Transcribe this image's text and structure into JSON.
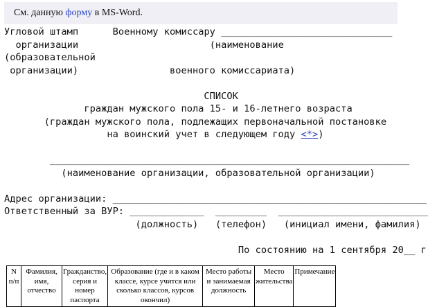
{
  "note": {
    "prefix": "См. данную ",
    "link": "форму",
    "suffix": " в MS-Word."
  },
  "doc": {
    "stamp_1": "Угловой штамп",
    "stamp_2": "организации",
    "stamp_3": "(образовательной",
    "stamp_4": "организации)",
    "addressee_label": "Военному комиссару",
    "addressee_hint_1": "(наименование",
    "addressee_hint_2": "военного комиссариата)",
    "title": "СПИСОК",
    "subtitle_1": "граждан мужского пола 15- и 16-летнего возраста",
    "subtitle_2": "(граждан мужского пола, подлежащих первоначальной постановке",
    "subtitle_3": "на воинский учет в следующем году",
    "footnote_ref": "<*>",
    "org_hint": "(наименование организации, образовательной организации)",
    "address_label": "Адрес организации:",
    "responsible_label": "Ответственный за ВУР:",
    "hint_position": "(должность)",
    "hint_phone": "(телефон)",
    "hint_name": "(инициал имени, фамилия)",
    "as_of": "По состоянию на 1 сентября 20__ г"
  },
  "table": {
    "headers": [
      "N п/п",
      "Фамилия, имя, отчество",
      "Гражданство, серия и номер паспорта",
      "Образование (где и в каком классе, курсе учится или сколько классов, курсов окончил)",
      "Место работы и занимаемая должность",
      "Место жительства",
      "Примечание"
    ]
  }
}
